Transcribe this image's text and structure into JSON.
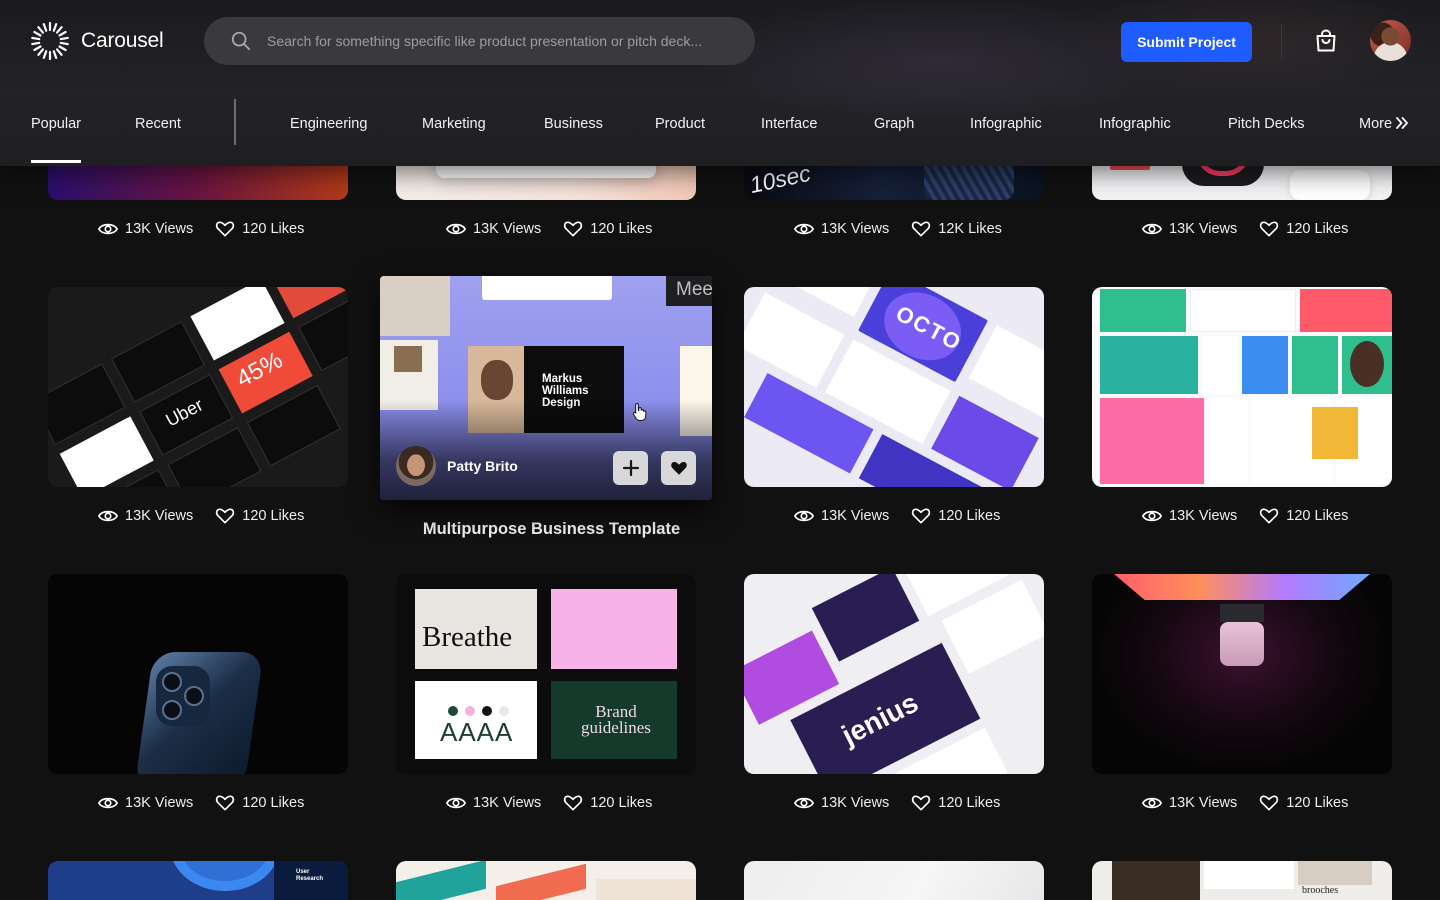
{
  "app": {
    "name": "Carousel"
  },
  "search": {
    "placeholder": "Search for something specific like product presentation or pitch deck..."
  },
  "header": {
    "submit_label": "Submit Project"
  },
  "nav": {
    "tabs": [
      "Popular",
      "Recent"
    ],
    "categories": [
      "Engineering",
      "Marketing",
      "Business",
      "Product",
      "Interface",
      "Graph",
      "Infographic",
      "Infographic",
      "Pitch Decks"
    ],
    "more_label": "More"
  },
  "cards": [
    {
      "views": "13K Views",
      "likes": "120 Likes"
    },
    {
      "views": "13K Views",
      "likes": "120 Likes"
    },
    {
      "views": "13K Views",
      "likes": "12K Likes",
      "thumb_text": "10sec"
    },
    {
      "views": "13K Views",
      "likes": "120 Likes"
    },
    {
      "views": "13K Views",
      "likes": "120 Likes",
      "thumb_text": "Uber",
      "thumb_extra": "45%"
    },
    {
      "title": "Multipurpose Business Template",
      "author": "Patty Brito",
      "thumb_text": "Markus Williams Design",
      "thumb_extra": "Mee"
    },
    {
      "views": "13K Views",
      "likes": "120 Likes",
      "thumb_text": "OCTO"
    },
    {
      "views": "13K Views",
      "likes": "120 Likes"
    },
    {
      "views": "13K Views",
      "likes": "120 Likes"
    },
    {
      "views": "13K Views",
      "likes": "120 Likes",
      "thumb_text": "Breathe",
      "thumb_extra": "Brand guidelines",
      "thumb_extra2": "AAAA"
    },
    {
      "views": "13K Views",
      "likes": "120 Likes",
      "thumb_text": "jenius"
    },
    {
      "views": "13K Views",
      "likes": "120 Likes"
    },
    {
      "thumb_text": "User Research"
    },
    {},
    {},
    {
      "thumb_text": "brooches"
    }
  ],
  "colors": {
    "accent": "#1f5cff",
    "background": "#111111",
    "header": "#202023"
  },
  "icons": [
    "carousel-logo-icon",
    "search-icon",
    "shopping-bag-icon",
    "eye-icon",
    "heart-icon",
    "plus-icon",
    "heart-filled-icon",
    "chevrons-right-icon",
    "hand-cursor-icon"
  ]
}
